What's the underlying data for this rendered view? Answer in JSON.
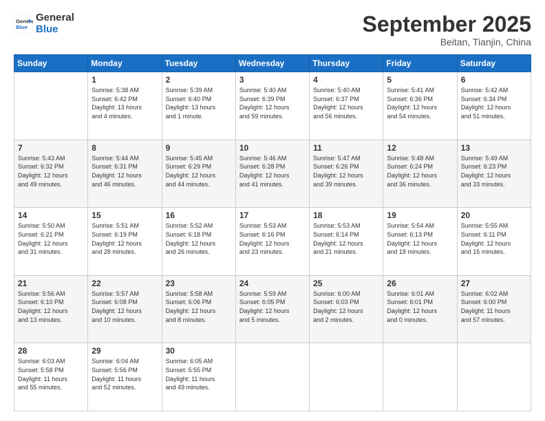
{
  "logo": {
    "line1": "General",
    "line2": "Blue"
  },
  "header": {
    "month": "September 2025",
    "location": "Beitan, Tianjin, China"
  },
  "weekdays": [
    "Sunday",
    "Monday",
    "Tuesday",
    "Wednesday",
    "Thursday",
    "Friday",
    "Saturday"
  ],
  "weeks": [
    [
      {
        "day": "",
        "info": ""
      },
      {
        "day": "1",
        "info": "Sunrise: 5:38 AM\nSunset: 6:42 PM\nDaylight: 13 hours\nand 4 minutes."
      },
      {
        "day": "2",
        "info": "Sunrise: 5:39 AM\nSunset: 6:40 PM\nDaylight: 13 hours\nand 1 minute."
      },
      {
        "day": "3",
        "info": "Sunrise: 5:40 AM\nSunset: 6:39 PM\nDaylight: 12 hours\nand 59 minutes."
      },
      {
        "day": "4",
        "info": "Sunrise: 5:40 AM\nSunset: 6:37 PM\nDaylight: 12 hours\nand 56 minutes."
      },
      {
        "day": "5",
        "info": "Sunrise: 5:41 AM\nSunset: 6:36 PM\nDaylight: 12 hours\nand 54 minutes."
      },
      {
        "day": "6",
        "info": "Sunrise: 5:42 AM\nSunset: 6:34 PM\nDaylight: 12 hours\nand 51 minutes."
      }
    ],
    [
      {
        "day": "7",
        "info": "Sunrise: 5:43 AM\nSunset: 6:32 PM\nDaylight: 12 hours\nand 49 minutes."
      },
      {
        "day": "8",
        "info": "Sunrise: 5:44 AM\nSunset: 6:31 PM\nDaylight: 12 hours\nand 46 minutes."
      },
      {
        "day": "9",
        "info": "Sunrise: 5:45 AM\nSunset: 6:29 PM\nDaylight: 12 hours\nand 44 minutes."
      },
      {
        "day": "10",
        "info": "Sunrise: 5:46 AM\nSunset: 6:28 PM\nDaylight: 12 hours\nand 41 minutes."
      },
      {
        "day": "11",
        "info": "Sunrise: 5:47 AM\nSunset: 6:26 PM\nDaylight: 12 hours\nand 39 minutes."
      },
      {
        "day": "12",
        "info": "Sunrise: 5:48 AM\nSunset: 6:24 PM\nDaylight: 12 hours\nand 36 minutes."
      },
      {
        "day": "13",
        "info": "Sunrise: 5:49 AM\nSunset: 6:23 PM\nDaylight: 12 hours\nand 33 minutes."
      }
    ],
    [
      {
        "day": "14",
        "info": "Sunrise: 5:50 AM\nSunset: 6:21 PM\nDaylight: 12 hours\nand 31 minutes."
      },
      {
        "day": "15",
        "info": "Sunrise: 5:51 AM\nSunset: 6:19 PM\nDaylight: 12 hours\nand 28 minutes."
      },
      {
        "day": "16",
        "info": "Sunrise: 5:52 AM\nSunset: 6:18 PM\nDaylight: 12 hours\nand 26 minutes."
      },
      {
        "day": "17",
        "info": "Sunrise: 5:53 AM\nSunset: 6:16 PM\nDaylight: 12 hours\nand 23 minutes."
      },
      {
        "day": "18",
        "info": "Sunrise: 5:53 AM\nSunset: 6:14 PM\nDaylight: 12 hours\nand 21 minutes."
      },
      {
        "day": "19",
        "info": "Sunrise: 5:54 AM\nSunset: 6:13 PM\nDaylight: 12 hours\nand 18 minutes."
      },
      {
        "day": "20",
        "info": "Sunrise: 5:55 AM\nSunset: 6:11 PM\nDaylight: 12 hours\nand 15 minutes."
      }
    ],
    [
      {
        "day": "21",
        "info": "Sunrise: 5:56 AM\nSunset: 6:10 PM\nDaylight: 12 hours\nand 13 minutes."
      },
      {
        "day": "22",
        "info": "Sunrise: 5:57 AM\nSunset: 6:08 PM\nDaylight: 12 hours\nand 10 minutes."
      },
      {
        "day": "23",
        "info": "Sunrise: 5:58 AM\nSunset: 6:06 PM\nDaylight: 12 hours\nand 8 minutes."
      },
      {
        "day": "24",
        "info": "Sunrise: 5:59 AM\nSunset: 6:05 PM\nDaylight: 12 hours\nand 5 minutes."
      },
      {
        "day": "25",
        "info": "Sunrise: 6:00 AM\nSunset: 6:03 PM\nDaylight: 12 hours\nand 2 minutes."
      },
      {
        "day": "26",
        "info": "Sunrise: 6:01 AM\nSunset: 6:01 PM\nDaylight: 12 hours\nand 0 minutes."
      },
      {
        "day": "27",
        "info": "Sunrise: 6:02 AM\nSunset: 6:00 PM\nDaylight: 11 hours\nand 57 minutes."
      }
    ],
    [
      {
        "day": "28",
        "info": "Sunrise: 6:03 AM\nSunset: 5:58 PM\nDaylight: 11 hours\nand 55 minutes."
      },
      {
        "day": "29",
        "info": "Sunrise: 6:04 AM\nSunset: 5:56 PM\nDaylight: 11 hours\nand 52 minutes."
      },
      {
        "day": "30",
        "info": "Sunrise: 6:05 AM\nSunset: 5:55 PM\nDaylight: 11 hours\nand 49 minutes."
      },
      {
        "day": "",
        "info": ""
      },
      {
        "day": "",
        "info": ""
      },
      {
        "day": "",
        "info": ""
      },
      {
        "day": "",
        "info": ""
      }
    ]
  ]
}
